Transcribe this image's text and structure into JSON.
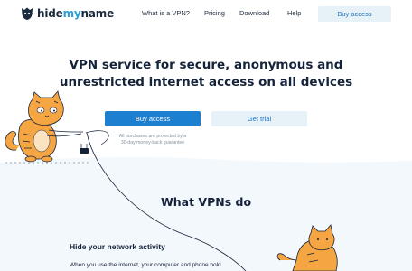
{
  "logo": {
    "part1": "hide",
    "part2": "my",
    "part3": "name"
  },
  "nav": {
    "items": [
      "What is a VPN?",
      "Pricing",
      "Download",
      "Help"
    ],
    "cta": "Buy access"
  },
  "hero": {
    "title_line1": "VPN service for secure, anonymous and",
    "title_line2": "unrestricted internet access on all devices",
    "buy_label": "Buy access",
    "trial_label": "Get trial",
    "guarantee_line1": "All purchases are protected by a",
    "guarantee_line2": "30-day money-back guarantee"
  },
  "section": {
    "title": "What VPNs do",
    "subhead": "Hide your network activity",
    "body": "When you use the internet, your computer and phone hold"
  },
  "colors": {
    "accent": "#1d7fd0",
    "accent_light": "#e7f1f8",
    "brand_blue": "#2a9fd6",
    "cat_orange": "#f5a541",
    "text_dark": "#15233a",
    "band_bg": "#f3f8fc"
  },
  "icons": [
    "logo-mark-icon",
    "cat-illustration",
    "cable-line",
    "router-icon"
  ]
}
